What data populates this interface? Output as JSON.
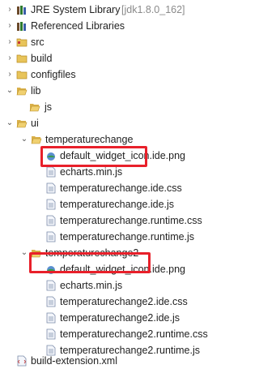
{
  "tree": {
    "items": [
      {
        "label": "JRE System Library",
        "decoration": "[jdk1.8.0_162]",
        "icon": "library-icon",
        "twisty": "collapsed"
      },
      {
        "label": "Referenced Libraries",
        "icon": "library-icon",
        "twisty": "collapsed"
      },
      {
        "label": "src",
        "icon": "source-folder-icon",
        "twisty": "collapsed"
      },
      {
        "label": "build",
        "icon": "folder-icon",
        "twisty": "collapsed"
      },
      {
        "label": "configfiles",
        "icon": "folder-icon",
        "twisty": "collapsed"
      },
      {
        "label": "lib",
        "icon": "folder-open-icon",
        "twisty": "expanded"
      },
      {
        "label": "js",
        "icon": "folder-open-icon",
        "twisty": "none"
      },
      {
        "label": "ui",
        "icon": "folder-open-icon",
        "twisty": "expanded"
      },
      {
        "label": "temperaturechange",
        "icon": "folder-open-icon",
        "twisty": "expanded"
      },
      {
        "label": "default_widget_icon.ide.png",
        "icon": "image-file-icon",
        "twisty": "none"
      },
      {
        "label": "echarts.min.js",
        "icon": "text-file-icon",
        "twisty": "none",
        "highlighted": true
      },
      {
        "label": "temperaturechange.ide.css",
        "icon": "text-file-icon",
        "twisty": "none"
      },
      {
        "label": "temperaturechange.ide.js",
        "icon": "text-file-icon",
        "twisty": "none"
      },
      {
        "label": "temperaturechange.runtime.css",
        "icon": "text-file-icon",
        "twisty": "none"
      },
      {
        "label": "temperaturechange.runtime.js",
        "icon": "text-file-icon",
        "twisty": "none"
      },
      {
        "label": "temperaturechange2",
        "icon": "folder-open-icon",
        "twisty": "expanded"
      },
      {
        "label": "default_widget_icon.ide.png",
        "icon": "image-file-icon",
        "twisty": "none"
      },
      {
        "label": "echarts.min.js",
        "icon": "text-file-icon",
        "twisty": "none",
        "highlighted": true
      },
      {
        "label": "temperaturechange2.ide.css",
        "icon": "text-file-icon",
        "twisty": "none"
      },
      {
        "label": "temperaturechange2.ide.js",
        "icon": "text-file-icon",
        "twisty": "none"
      },
      {
        "label": "temperaturechange2.runtime.css",
        "icon": "text-file-icon",
        "twisty": "none"
      },
      {
        "label": "temperaturechange2.runtime.js",
        "icon": "text-file-icon",
        "twisty": "none"
      },
      {
        "label": "build-extension.xml",
        "icon": "xml-file-icon",
        "twisty": "none"
      }
    ]
  },
  "colors": {
    "highlight": "#e8202a",
    "decoration": "#8a8a8a",
    "folder": "#e8c45a"
  }
}
